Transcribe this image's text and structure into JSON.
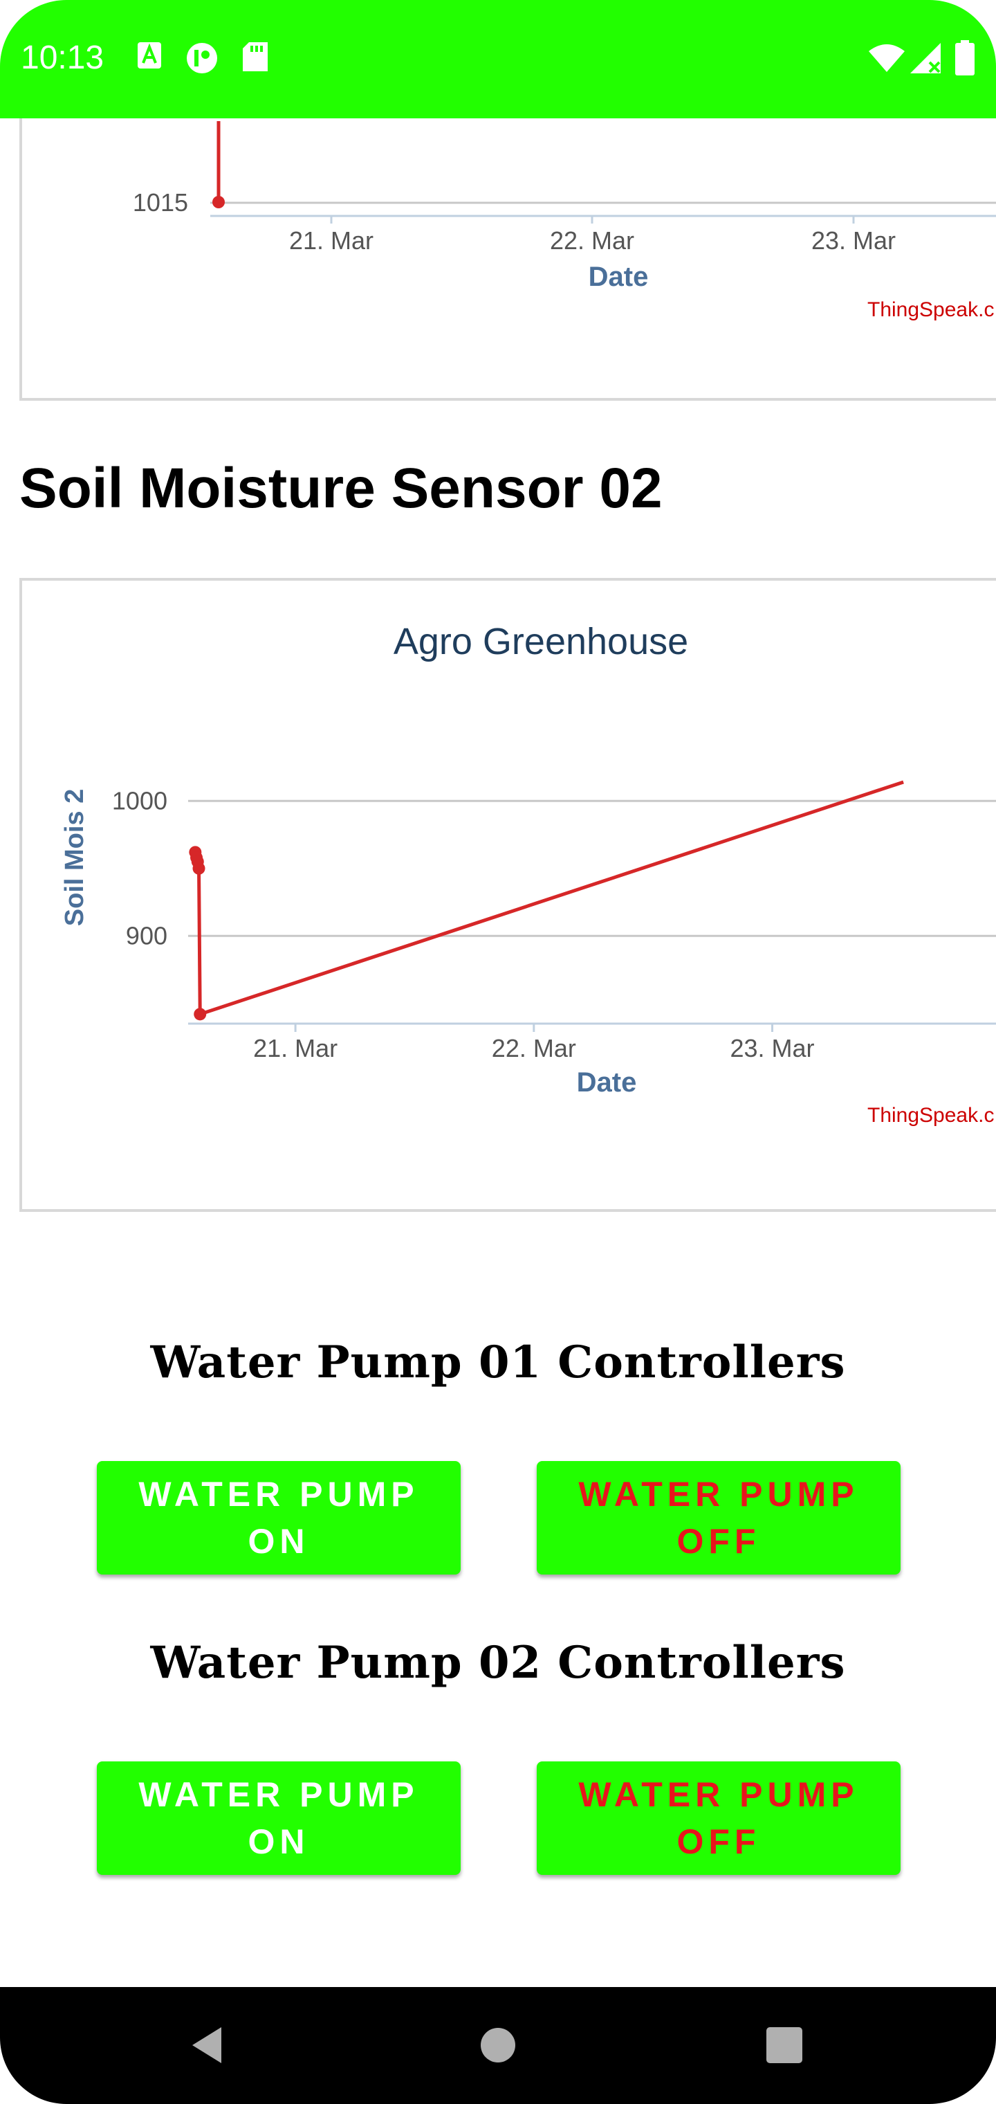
{
  "status_bar": {
    "time": "10:13",
    "left_icons": [
      "font-a-icon",
      "app-badge-icon",
      "sd-card-icon"
    ],
    "right_icons": [
      "wifi-icon",
      "signal-icon",
      "battery-icon"
    ],
    "color": "#22ff00"
  },
  "chart_top": {
    "ytick": "1015",
    "xticks": [
      "21. Mar",
      "22. Mar",
      "23. Mar"
    ],
    "xlabel": "Date",
    "credit": "ThingSpeak.c"
  },
  "section": {
    "title": "Soil Moisture Sensor 02"
  },
  "chart_data": [
    {
      "type": "line",
      "title": "",
      "xlabel": "Date",
      "xticks": [
        "21. Mar",
        "22. Mar",
        "23. Mar"
      ],
      "yticks": [
        "1015"
      ],
      "series": [
        {
          "color": "#d62728",
          "points": [
            {
              "x": "20. Mar",
              "y": 1015
            }
          ]
        }
      ],
      "credit": "ThingSpeak.c"
    },
    {
      "type": "line",
      "title": "Agro Greenhouse",
      "xlabel": "Date",
      "ylabel": "Soil Mois 2",
      "xticks": [
        "21. Mar",
        "22. Mar",
        "23. Mar"
      ],
      "yticks": [
        "1000",
        "900"
      ],
      "ylim": [
        835,
        1035
      ],
      "grid": true,
      "series": [
        {
          "color": "#d62728",
          "points": [
            {
              "x": 20.58,
              "y": 962
            },
            {
              "x": 20.585,
              "y": 958
            },
            {
              "x": 20.59,
              "y": 955
            },
            {
              "x": 20.595,
              "y": 950
            },
            {
              "x": 20.6,
              "y": 842
            },
            {
              "x": 23.55,
              "y": 1014
            }
          ]
        }
      ],
      "credit": "ThingSpeak.c"
    }
  ],
  "pump1": {
    "title": "Water Pump 01 Controllers",
    "on_label": "WATER PUMP\nON",
    "off_label": "WATER PUMP\nOFF"
  },
  "pump2": {
    "title": "Water Pump 02 Controllers",
    "on_label": "WATER PUMP\nON",
    "off_label": "WATER PUMP\nOFF"
  },
  "colors": {
    "accent": "#22ff00",
    "on_text": "#ffffff",
    "off_text": "#e8141c",
    "line": "#d62728",
    "axis_label": "#4a6f99",
    "chart_title": "#1f3d5c"
  },
  "nav": {
    "icons": [
      "back-icon",
      "home-icon",
      "recents-icon"
    ]
  }
}
